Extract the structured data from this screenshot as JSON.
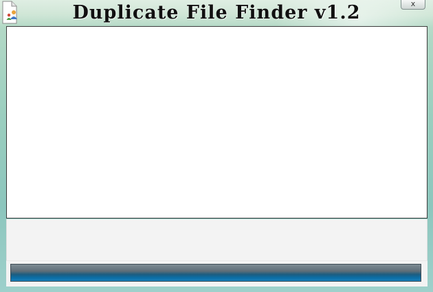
{
  "window": {
    "title": "Duplicate File Finder v1.2",
    "app_icon": "document-user-icon",
    "close_glyph": "x"
  },
  "results": {
    "items": []
  },
  "status": {
    "text": ""
  },
  "progress": {
    "fraction": 0
  },
  "colors": {
    "progress_blue": "#0b6ea6",
    "progress_gray": "#5e6e78",
    "background_mint": "#9ccfbf"
  }
}
